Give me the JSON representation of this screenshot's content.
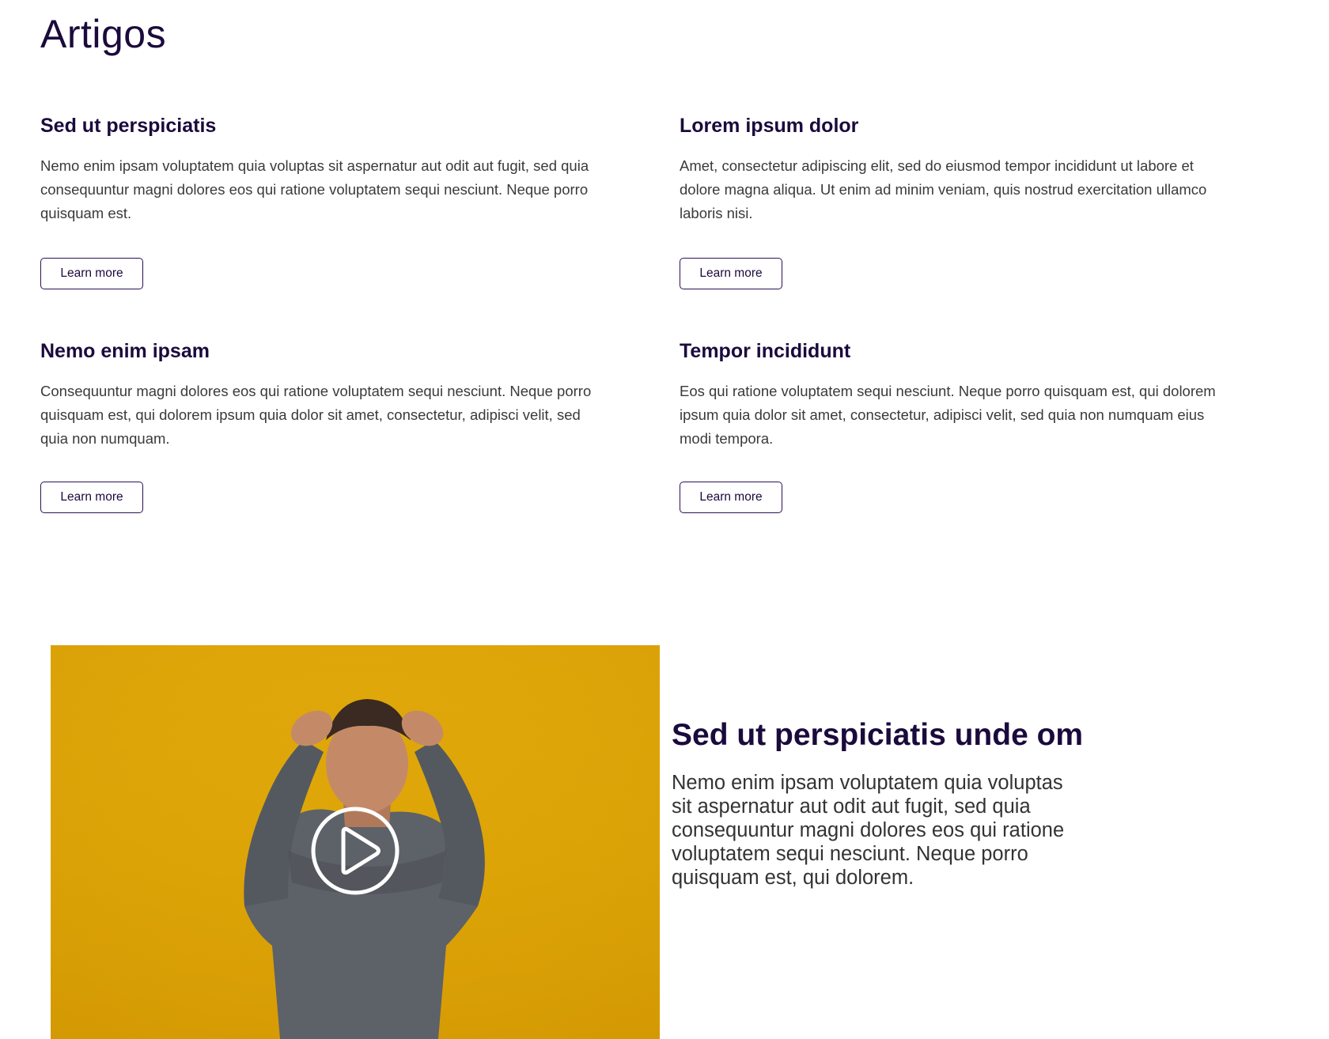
{
  "section": {
    "title": "Artigos"
  },
  "articles": [
    {
      "title": "Sed ut perspiciatis",
      "text": "Nemo enim ipsam voluptatem quia voluptas sit aspernatur aut odit aut fugit, sed quia consequuntur magni dolores eos qui ratione voluptatem sequi nesciunt. Neque porro quisquam est.",
      "button_label": "Learn more"
    },
    {
      "title": "Lorem ipsum dolor",
      "text": "Amet, consectetur adipiscing elit, sed do eiusmod tempor incididunt ut labore et dolore magna aliqua. Ut enim ad minim veniam, quis nostrud exercitation ullamco laboris nisi.",
      "button_label": "Learn more"
    },
    {
      "title": "Nemo enim ipsam",
      "text": "Consequuntur magni dolores eos qui ratione voluptatem sequi nesciunt. Neque porro quisquam est, qui dolorem ipsum quia dolor sit amet, consectetur, adipisci velit, sed quia non numquam.",
      "button_label": "Learn more"
    },
    {
      "title": "Tempor incididunt",
      "text": "Eos qui ratione voluptatem sequi nesciunt. Neque porro quisquam est, qui dolorem ipsum quia dolor sit amet, consectetur, adipisci velit, sed quia non numquam eius modi tempora.",
      "button_label": "Learn more"
    }
  ],
  "feature": {
    "title": "Sed ut perspiciatis unde om",
    "text": "Nemo enim ipsam voluptatem quia voluptas sit aspernatur aut odit aut fugit, sed quia consequuntur magni dolores eos qui ratione voluptatem sequi nesciunt. Neque porro quisquam est, qui dolorem.",
    "play_icon": "play-circle-icon"
  },
  "colors": {
    "heading": "#1b0a3c",
    "button_border": "#2a1254",
    "video_background": "#dca406",
    "body_text": "#3a3a3a"
  }
}
